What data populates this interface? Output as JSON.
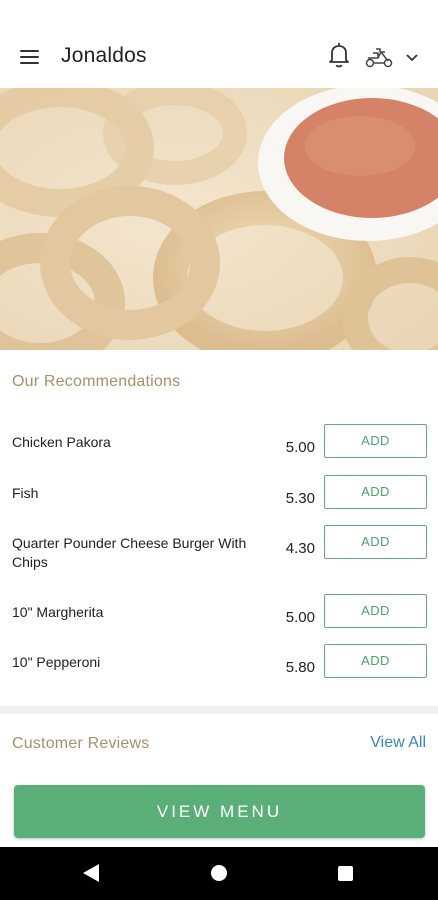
{
  "app_bar": {
    "title": "Jonaldos",
    "menu_icon": "hamburger-menu-icon",
    "notification_icon": "bell-icon",
    "delivery_icon": "scooter-icon",
    "dropdown_icon": "chevron-down-icon"
  },
  "hero": {
    "description_icon": "food-photo",
    "colors": {
      "sauce": "#c4542e",
      "batter": "#d7b27a",
      "bowl": "#f4f2ee"
    }
  },
  "recommendations": {
    "title": "Our Recommendations",
    "items": [
      {
        "name": "Chicken Pakora",
        "price": "5.00",
        "button": "ADD"
      },
      {
        "name": "Fish",
        "price": "5.30",
        "button": "ADD"
      },
      {
        "name": "Quarter Pounder Cheese Burger With Chips",
        "price": "4.30",
        "button": "ADD"
      },
      {
        "name": "10\" Margherita",
        "price": "5.00",
        "button": "ADD"
      },
      {
        "name": "10\" Pepperoni",
        "price": "5.80",
        "button": "ADD"
      }
    ]
  },
  "reviews": {
    "title": "Customer Reviews",
    "view_all": "View All"
  },
  "cta": {
    "label": "VIEW MENU"
  },
  "colors": {
    "accent_green": "#5aaf78",
    "section_title": "#a5926a",
    "link_blue": "#3b86b8"
  },
  "nav_bar": {
    "back_icon": "back-triangle-icon",
    "home_icon": "home-circle-icon",
    "recents_icon": "recents-square-icon"
  }
}
